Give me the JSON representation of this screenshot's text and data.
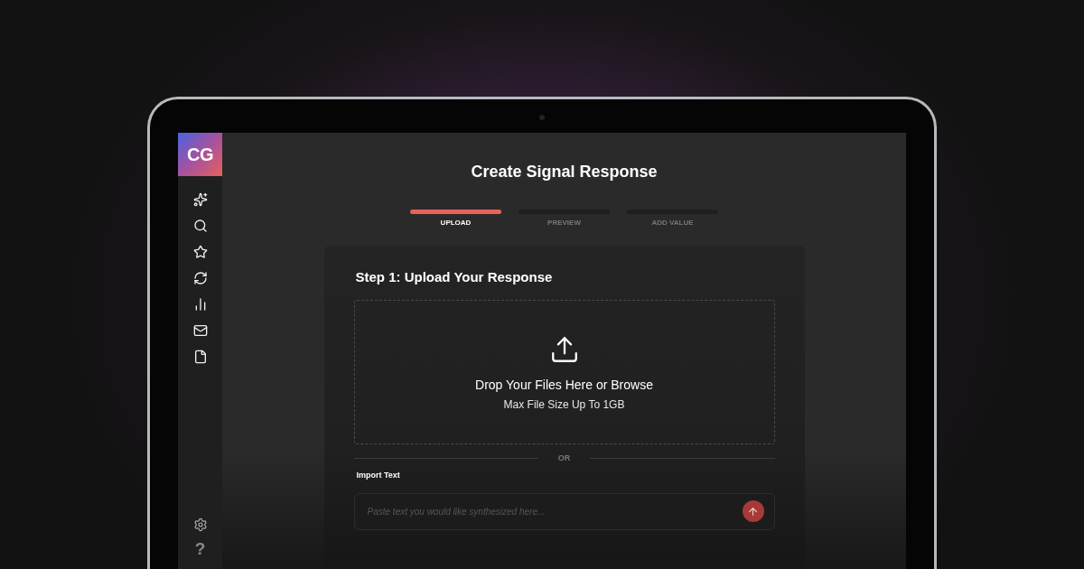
{
  "logo": "CG",
  "sidebar": {
    "help": "?"
  },
  "page": {
    "title": "Create Signal Response"
  },
  "steps": [
    {
      "label": "UPLOAD",
      "selected": true
    },
    {
      "label": "PREVIEW",
      "selected": false
    },
    {
      "label": "ADD VALUE",
      "selected": false
    }
  ],
  "card": {
    "heading": "Step 1: Upload Your Response",
    "drop_title": "Drop Your Files Here or Browse",
    "drop_hint": "Max File Size Up To 1GB",
    "divider": "OR",
    "import_label": "Import Text",
    "import_placeholder": "Paste text you would like synthesized here..."
  }
}
